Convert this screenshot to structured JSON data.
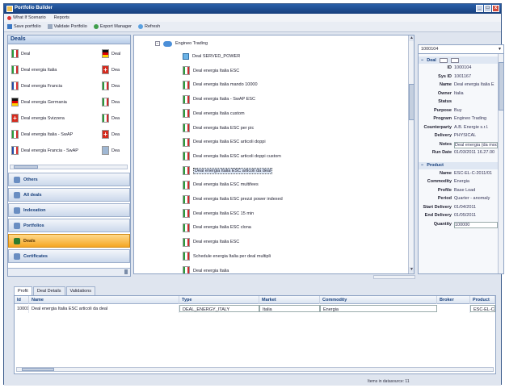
{
  "window": {
    "title": "Portfolio Builder",
    "controls": [
      "_",
      "□",
      "x"
    ]
  },
  "menu": {
    "whatif": "What If Scenario",
    "reports": "Reports"
  },
  "toolbar": {
    "save": "Save portfolio",
    "validate": "Validate Portfolio",
    "export": "Export Manager",
    "refresh": "Refresh"
  },
  "left_panel": {
    "title": "Deals",
    "deals_col1": [
      {
        "label": "Deal",
        "flag": "it"
      },
      {
        "label": "Deal energia Italia",
        "flag": "it"
      },
      {
        "label": "Deal energia Francia",
        "flag": "fr"
      },
      {
        "label": "Deal energia Germania",
        "flag": "de"
      },
      {
        "label": "Deal energia Svizzera",
        "flag": "ch"
      },
      {
        "label": "Deal energia Italia - SwAP",
        "flag": "it"
      },
      {
        "label": "Deal energia Francia - SwAP",
        "flag": "fr"
      }
    ],
    "deals_col2": [
      {
        "label": "Deal",
        "flag": "de"
      },
      {
        "label": "Dea",
        "flag": "ch"
      },
      {
        "label": "Dea",
        "flag": "it"
      },
      {
        "label": "Dea",
        "flag": "it"
      },
      {
        "label": "Dea",
        "flag": "it"
      },
      {
        "label": "Dea",
        "flag": "ch"
      },
      {
        "label": "Dea",
        "flag": "x"
      }
    ],
    "nav": [
      {
        "label": "Others",
        "active": false
      },
      {
        "label": "All deals",
        "active": false
      },
      {
        "label": "Indexation",
        "active": false
      },
      {
        "label": "Portfolios",
        "active": false
      },
      {
        "label": "Deals",
        "active": true
      },
      {
        "label": "Certificates",
        "active": false
      }
    ]
  },
  "tree": {
    "root": "Engineo Trading",
    "items": [
      {
        "label": "Deal SERVED_POWER",
        "icon": "leaf"
      },
      {
        "label": "Deal energia Italia ESC",
        "icon": "flag-it"
      },
      {
        "label": "Deal energia Italia mando 10000",
        "icon": "flag-it"
      },
      {
        "label": "Deal energia Italia - SwAP ESC",
        "icon": "flag-it"
      },
      {
        "label": "Deal energia Italia custom",
        "icon": "flag-it"
      },
      {
        "label": "Deal energia Italia ESC per pic",
        "icon": "flag-it"
      },
      {
        "label": "Deal energia Italia ESC articoli doppi",
        "icon": "flag-it"
      },
      {
        "label": "Deal energia Italia ESC articoli doppi custom",
        "icon": "flag-it"
      },
      {
        "label": "Deal energia Italia ESC articoli da deal",
        "icon": "flag-it",
        "selected": true
      },
      {
        "label": "Deal energia Italia ESC multifees",
        "icon": "flag-it"
      },
      {
        "label": "Deal energia Italia ESC prezzi power indexed",
        "icon": "flag-it"
      },
      {
        "label": "Deal energia Italia ESC 15 min",
        "icon": "flag-it"
      },
      {
        "label": "Deal energia Italia ESC clona",
        "icon": "flag-it"
      },
      {
        "label": "Deal energia Italia ESC",
        "icon": "flag-it"
      },
      {
        "label": "Schedule energia Italia per deal multipli",
        "icon": "flag-it"
      },
      {
        "label": "Deal energia Italia",
        "icon": "flag-it"
      }
    ]
  },
  "properties": {
    "id_value": "1000104",
    "group_deal": "Deal",
    "group_product": "Product",
    "rows": [
      {
        "key": "ID",
        "value": "1000104"
      },
      {
        "key": "Sys ID",
        "value": "1001167"
      },
      {
        "key": "Name",
        "value": "Deal energia Italia E"
      },
      {
        "key": "Owner",
        "value": "Italia"
      },
      {
        "key": "Status",
        "value": ""
      },
      {
        "key": "Purpose",
        "value": "Buy"
      },
      {
        "key": "Program",
        "value": "Engineo Trading"
      },
      {
        "key": "Counterparty",
        "value": "A.B. Energie s.r.l."
      },
      {
        "key": "Delivery",
        "value": "PHYSICAL"
      },
      {
        "key": "Notes",
        "value": "Deal energia (da modif"
      },
      {
        "key": "Run Date",
        "value": "01/03/2011 16.27.00"
      }
    ],
    "product_rows": [
      {
        "key": "Name",
        "value": "ESC-EL-C-2011/01"
      },
      {
        "key": "Commodity",
        "value": "Energia"
      },
      {
        "key": "Profile",
        "value": "Base Load"
      },
      {
        "key": "Period",
        "value": "Quarter - anomaly"
      },
      {
        "key": "Start Delivery",
        "value": "01/04/2011"
      },
      {
        "key": "End Delivery",
        "value": "01/05/2011"
      },
      {
        "key": "Quantity",
        "value": "100000"
      }
    ]
  },
  "bottom": {
    "tabs": [
      {
        "label": "Profit",
        "active": true
      },
      {
        "label": "Deal Details",
        "active": false
      },
      {
        "label": "Validations",
        "active": false
      }
    ],
    "columns": [
      "Id",
      "Name",
      "Type",
      "Market",
      "Commodity",
      "Broker",
      "Product"
    ],
    "rows": [
      [
        "1000104",
        "Deal energia Italia ESC articoli da deal",
        "DEAL_ENERGY_ITALY",
        "Italia",
        "Energia",
        "",
        "ESC-EL-C-201"
      ]
    ]
  },
  "status": {
    "text": "Items in datasource: 11"
  },
  "colors": {
    "accent": "#173f7c",
    "active_nav": "#f5a623",
    "titlebar": "#2a5fa8"
  }
}
